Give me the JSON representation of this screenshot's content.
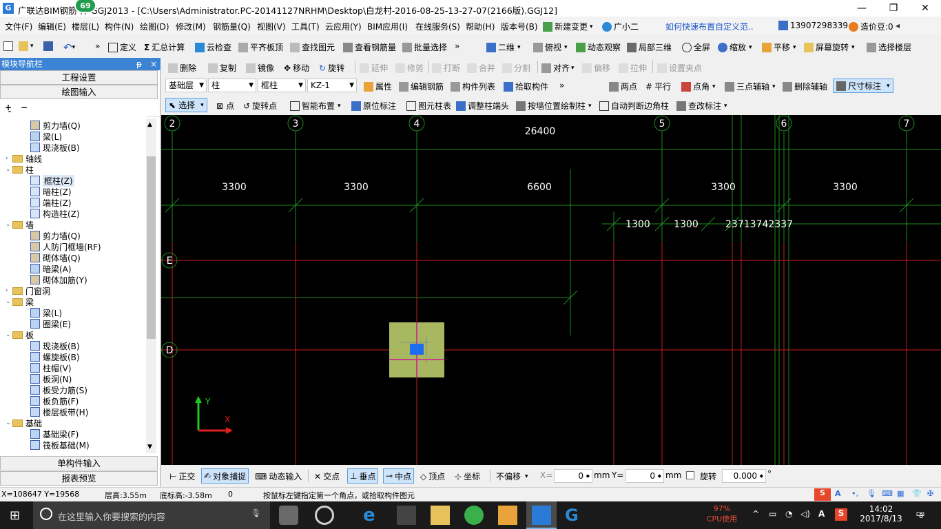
{
  "window": {
    "app_icon": "G",
    "title": "广联达BIM钢筋   件 GGJ2013 - [C:\\Users\\Administrator.PC-20141127NRHM\\Desktop\\白龙村-2016-08-25-13-27-07(2166版).GGJ12]",
    "badge": "69",
    "minimize": "—",
    "maximize": "❐",
    "close": "✕"
  },
  "menu": {
    "items": [
      "文件(F)",
      "编辑(E)",
      "楼层(L)",
      "构件(N)",
      "绘图(D)",
      "修改(M)",
      "钢筋量(Q)",
      "视图(V)",
      "工具(T)",
      "云应用(Y)",
      "BIM应用(I)",
      "在线服务(S)",
      "帮助(H)",
      "版本号(B)"
    ],
    "new_change": "新建变更",
    "assistant": "广小二",
    "tip_link": "如何快速布置自定义范..",
    "phone": "13907298339",
    "price_bean": "造价豆:0"
  },
  "toolbar1": {
    "items": [
      "定义",
      "汇总计算",
      "云检查",
      "平齐板顶",
      "查找图元",
      "查看钢筋量",
      "批量选择",
      "二维",
      "俯视",
      "动态观察",
      "局部三维",
      "全屏",
      "缩放",
      "平移",
      "屏幕旋转",
      "选择楼层"
    ]
  },
  "toolbar2": {
    "items": [
      "删除",
      "复制",
      "镜像",
      "移动",
      "旋转",
      "延伸",
      "修剪",
      "打断",
      "合并",
      "分割",
      "对齐",
      "偏移",
      "拉伸",
      "设置夹点"
    ]
  },
  "toolbar3": {
    "floor": "基础层",
    "type": "柱",
    "subtype": "框柱",
    "component": "KZ-1",
    "items": [
      "属性",
      "编辑钢筋",
      "构件列表",
      "拾取构件",
      "两点",
      "平行",
      "点角",
      "三点辅轴",
      "删除辅轴",
      "尺寸标注"
    ]
  },
  "toolbar4": {
    "items": [
      "选择",
      "点",
      "旋转点",
      "智能布置",
      "原位标注",
      "图元柱表",
      "调整柱端头",
      "按墙位置绘制柱",
      "自动判断边角柱",
      "查改标注"
    ]
  },
  "left_panel": {
    "title": "模块导航栏",
    "pin": "ᵽ",
    "close": "×",
    "project_settings": "工程设置",
    "drawing_input": "绘图输入",
    "single_input": "单构件输入",
    "report_preview": "报表预览",
    "tree": [
      {
        "label": "剪力墙(Q)",
        "level": 2,
        "icon": "wall"
      },
      {
        "label": "梁(L)",
        "level": 2,
        "icon": "beam"
      },
      {
        "label": "现浇板(B)",
        "level": 2,
        "icon": "slab"
      },
      {
        "label": "轴线",
        "level": 0,
        "icon": "folder",
        "toggle": "›"
      },
      {
        "label": "柱",
        "level": 0,
        "icon": "folder",
        "toggle": "⌄"
      },
      {
        "label": "框柱(Z)",
        "level": 2,
        "icon": "col",
        "selected": true
      },
      {
        "label": "暗柱(Z)",
        "level": 2,
        "icon": "col"
      },
      {
        "label": "端柱(Z)",
        "level": 2,
        "icon": "col"
      },
      {
        "label": "构造柱(Z)",
        "level": 2,
        "icon": "col"
      },
      {
        "label": "墙",
        "level": 0,
        "icon": "folder",
        "toggle": "⌄"
      },
      {
        "label": "剪力墙(Q)",
        "level": 2,
        "icon": "wall"
      },
      {
        "label": "人防门框墙(RF)",
        "level": 2,
        "icon": "wall"
      },
      {
        "label": "砌体墙(Q)",
        "level": 2,
        "icon": "wall"
      },
      {
        "label": "暗梁(A)",
        "level": 2,
        "icon": "beam"
      },
      {
        "label": "砌体加筋(Y)",
        "level": 2,
        "icon": "wall"
      },
      {
        "label": "门窗洞",
        "level": 0,
        "icon": "folder",
        "toggle": "›"
      },
      {
        "label": "梁",
        "level": 0,
        "icon": "folder",
        "toggle": "⌄"
      },
      {
        "label": "梁(L)",
        "level": 2,
        "icon": "beam"
      },
      {
        "label": "圈梁(E)",
        "level": 2,
        "icon": "beam"
      },
      {
        "label": "板",
        "level": 0,
        "icon": "folder",
        "toggle": "⌄"
      },
      {
        "label": "现浇板(B)",
        "level": 2,
        "icon": "slab"
      },
      {
        "label": "螺旋板(B)",
        "level": 2,
        "icon": "slab"
      },
      {
        "label": "柱帽(V)",
        "level": 2,
        "icon": "slab"
      },
      {
        "label": "板洞(N)",
        "level": 2,
        "icon": "slab"
      },
      {
        "label": "板受力筋(S)",
        "level": 2,
        "icon": "slab"
      },
      {
        "label": "板负筋(F)",
        "level": 2,
        "icon": "slab"
      },
      {
        "label": "楼层板带(H)",
        "level": 2,
        "icon": "slab"
      },
      {
        "label": "基础",
        "level": 0,
        "icon": "folder",
        "toggle": "⌄"
      },
      {
        "label": "基础梁(F)",
        "level": 2,
        "icon": "beam"
      },
      {
        "label": "筏板基础(M)",
        "level": 2,
        "icon": "slab"
      }
    ]
  },
  "canvas": {
    "axis_labels_top": [
      "2",
      "3",
      "4",
      "5",
      "6",
      "7"
    ],
    "axis_labels_left": [
      "E",
      "D"
    ],
    "dim_total": "26400",
    "dims_row1": [
      "3300",
      "3300",
      "6600",
      "3300",
      "3300"
    ],
    "dims_row2": [
      "1300",
      "1300",
      "23713742337"
    ],
    "axis_x": "X",
    "axis_y": "Y"
  },
  "bottombar": {
    "ortho": "正交",
    "snap": "对象捕捉",
    "dynamic_input": "动态输入",
    "intersection": "交点",
    "perpendicular": "垂点",
    "midpoint": "中点",
    "vertex": "顶点",
    "coordinate": "坐标",
    "offset_mode": "不偏移",
    "x_label": "X=",
    "x_value": "0",
    "y_label": "Y=",
    "y_value": "0",
    "unit": "mm",
    "rotate_label": "旋转",
    "rotate_value": "0.000",
    "degree": "°"
  },
  "status": {
    "coords": "X=108647  Y=19568",
    "floor_height": "层高:3.55m",
    "floor_bottom": "底标高:-3.58m",
    "zero": "0",
    "hint": "按鼠标左键指定第一个角点，或拾取构件图元"
  },
  "taskbar": {
    "search_placeholder": "在这里输入你要搜索的内容",
    "cpu_percent": "97%",
    "cpu_label": "CPU使用",
    "time": "14:02",
    "date": "2017/8/13",
    "notif_count": "8",
    "ime": "A"
  },
  "colors": {
    "canvas_bg": "#000000",
    "grid_green": "#1e8c1e",
    "grid_red": "#c81e1e",
    "selection_blue": "#3b83d4",
    "column_fill": "#a8b860"
  }
}
